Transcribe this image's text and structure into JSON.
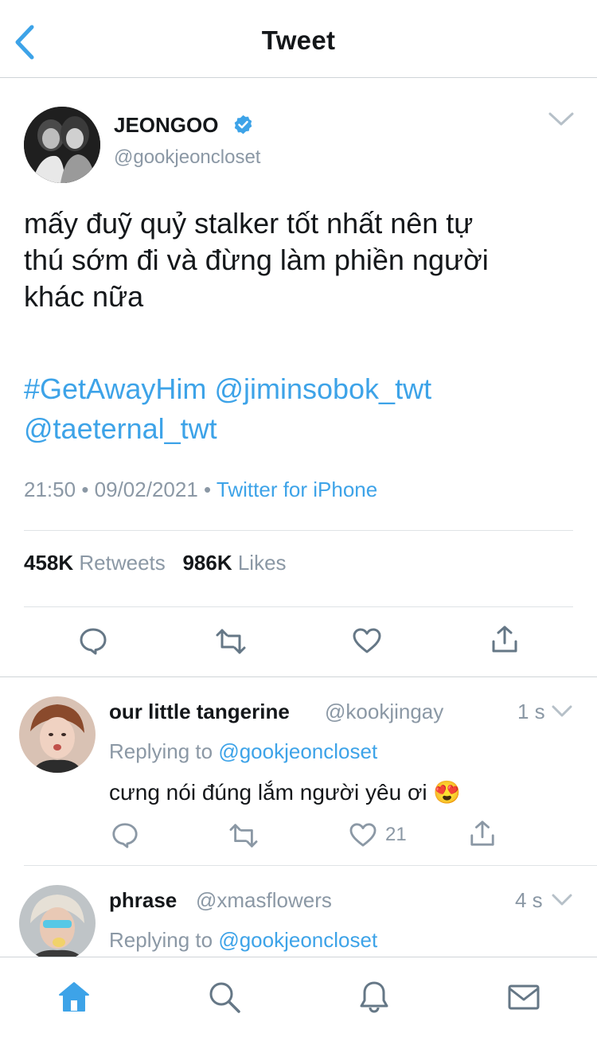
{
  "header": {
    "title": "Tweet"
  },
  "tweet": {
    "author_name": "JEONGOO",
    "author_handle": "@gookjeoncloset",
    "text_lines": [
      "mấy đuỹ quỷ stalker tốt nhất nên tự",
      "thú sớm đi và đừng làm phiền người",
      "khác nữa"
    ],
    "hashtag": "#GetAwayHim",
    "mention_1": "@jiminsobok_twt",
    "mention_2": "@taeternal_twt",
    "time": "21:50",
    "date": "09/02/2021",
    "separator": "•",
    "source": "Twitter for iPhone",
    "retweets_count": "458K",
    "retweets_label": "Retweets",
    "likes_count": "986K",
    "likes_label": "Likes"
  },
  "replies": [
    {
      "name": "our little tangerine",
      "handle": "@kookjingay",
      "time": "1 s",
      "replying_prefix": "Replying to",
      "replying_to": "@gookjeoncloset",
      "text": "cưng nói đúng lắm người yêu ơi",
      "emoji": "😍",
      "likes": "21"
    },
    {
      "name": "phrase",
      "handle": "@xmasflowers",
      "time": "4 s",
      "replying_prefix": "Replying to",
      "replying_to": "@gookjeoncloset"
    }
  ],
  "icons": {
    "back": "chevron-left-icon",
    "verified": "verified-badge-icon",
    "more": "chevron-down-icon",
    "reply": "reply-icon",
    "retweet": "retweet-icon",
    "like": "heart-icon",
    "share": "share-icon",
    "tab_home": "home-icon",
    "tab_search": "search-icon",
    "tab_notifications": "bell-icon",
    "tab_messages": "mail-icon"
  },
  "colors": {
    "accent": "#3da3e8",
    "secondary_text": "#8b98a5",
    "divider": "#dfe3e6"
  }
}
